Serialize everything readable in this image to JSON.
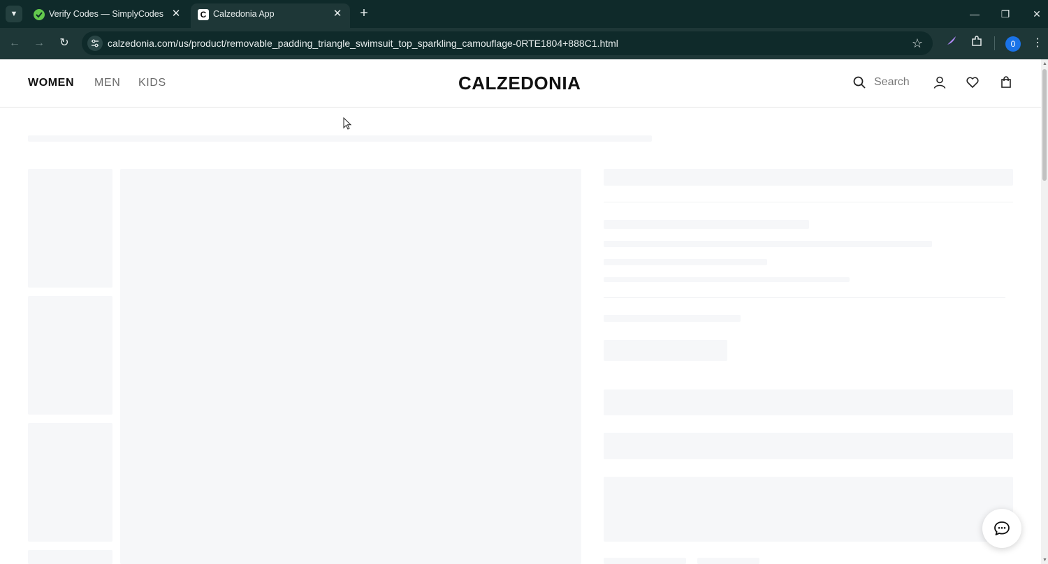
{
  "browser": {
    "tabs": [
      {
        "title": "Verify Codes — SimplyCodes",
        "active": false
      },
      {
        "title": "Calzedonia App",
        "active": true
      }
    ],
    "url": "calzedonia.com/us/product/removable_padding_triangle_swimsuit_top_sparkling_camouflage-0RTE1804+888C1.html",
    "profile_initial": "0",
    "icons": [
      "tab-list-icon",
      "close-icon",
      "new-tab-icon",
      "minimize-icon",
      "restore-icon",
      "back-icon",
      "forward-icon",
      "reload-icon",
      "site-info-icon",
      "bookmark-star-icon",
      "extension-feather-icon",
      "extensions-puzzle-icon",
      "menu-dots-icon"
    ]
  },
  "site": {
    "logo": "CALZEDONIA",
    "categories": [
      "WOMEN",
      "MEN",
      "KIDS"
    ],
    "active_category": "WOMEN",
    "search_label": "Search",
    "header_icons": [
      "search-icon",
      "account-icon",
      "wishlist-heart-icon",
      "shopping-bag-icon"
    ],
    "chat_icon": "chat-bubble-icon",
    "page_state": "loading skeleton"
  }
}
